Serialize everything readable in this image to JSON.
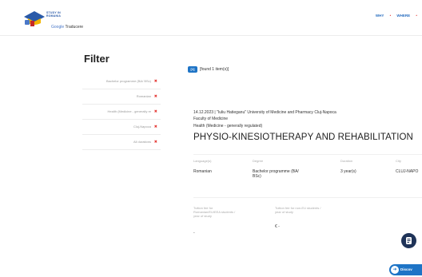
{
  "header": {
    "logo_lines": [
      "STUDY IN",
      "ROMANIA"
    ],
    "translate_prefix": "Google",
    "translate_label": "Traducere",
    "nav": [
      "WHY",
      "WHERE"
    ]
  },
  "filter": {
    "title": "Filter",
    "items": [
      "Bachelor programme (BA/ BSc)",
      "Romanian",
      "Health (Medicine - generally re",
      "Cluj-Napoca",
      "All durations"
    ]
  },
  "results": {
    "count": "[1]",
    "label": "[found 1 item(s)]"
  },
  "program": {
    "meta": "14.12.2023 | \"Iuliu Hatieganu\" University of Medicine and Pharmacy Cluj-Napoca",
    "faculty": "Faculty of Medicine",
    "field": "Health (Medicine - generally regulated)",
    "title": "PHYSIO-KINESIOTHERAPY AND REHABILITATION",
    "details": {
      "language_label": "Language(s)",
      "language": "Romanian",
      "degree_label": "Degree",
      "degree": "Bachelor programme (BA/ BSc)",
      "duration_label": "Duration",
      "duration": "3 year(s)",
      "city_label": "City",
      "city": "CLUJ-NAPO"
    },
    "fees": {
      "eu_label": "Tuition fee for Romanian/EU/EEA students / year of study",
      "eu_value": "-",
      "noneu_label": "Tuition fee for non-EU students / year of study",
      "noneu_value": "€ -"
    }
  },
  "discover_button": "Discov",
  "colors": {
    "accent": "#1e74c6",
    "remove": "#e53935",
    "dark_badge": "#1f3358"
  }
}
